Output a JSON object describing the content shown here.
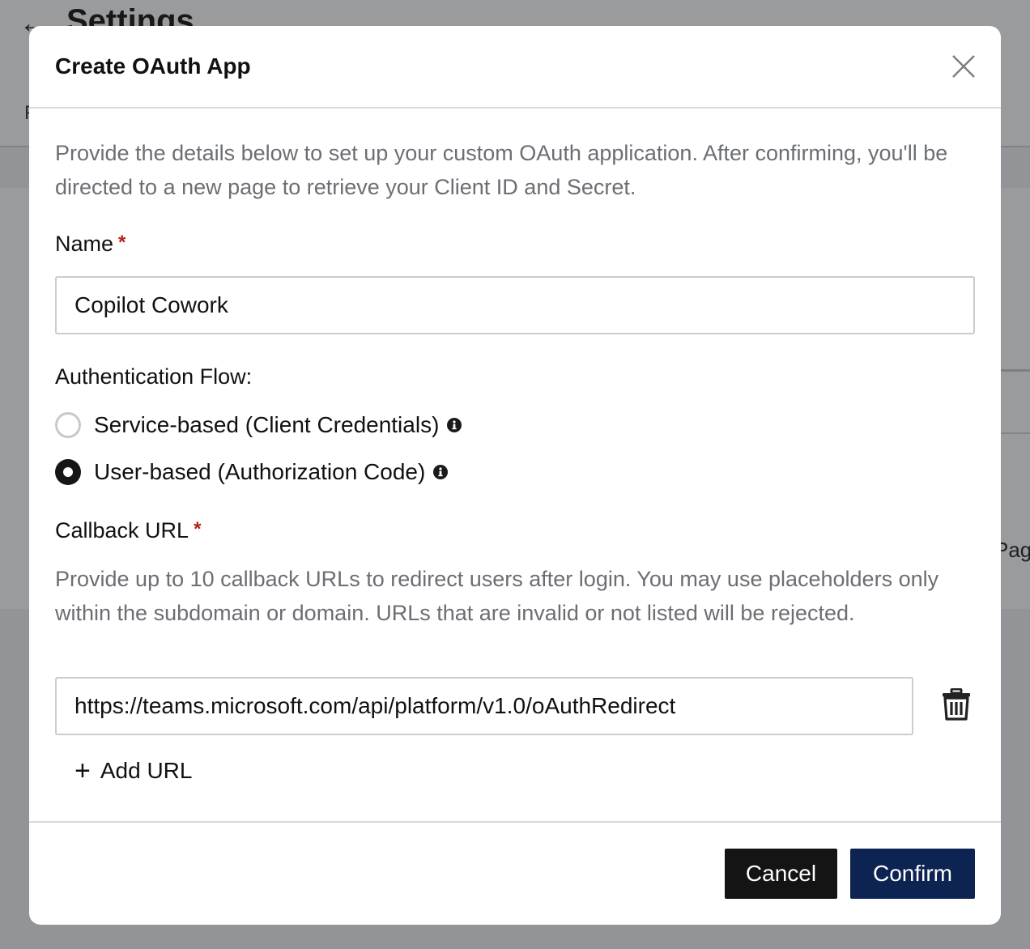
{
  "background": {
    "back_arrow": "←",
    "page_title": "Settings",
    "tab_fragment": "F",
    "pagination_fragment": "Pag"
  },
  "modal": {
    "title": "Create OAuth App",
    "close_icon": "close-icon",
    "intro": "Provide the details below to set up your custom OAuth application. After confirming, you'll be directed to a new page to retrieve your Client ID and Secret.",
    "name": {
      "label": "Name",
      "required_mark": "*",
      "value": "Copilot Cowork"
    },
    "auth_flow": {
      "label": "Authentication Flow:",
      "options": [
        {
          "label": "Service-based (Client Credentials)",
          "selected": false
        },
        {
          "label": "User-based (Authorization Code)",
          "selected": true
        }
      ]
    },
    "callback": {
      "label": "Callback URL",
      "required_mark": "*",
      "help": "Provide up to 10 callback URLs to redirect users after login. You may use placeholders only within the subdomain or domain. URLs that are invalid or not listed will be rejected.",
      "urls": [
        "https://teams.microsoft.com/api/platform/v1.0/oAuthRedirect"
      ],
      "add_label": "Add URL"
    },
    "footer": {
      "cancel_label": "Cancel",
      "confirm_label": "Confirm"
    }
  },
  "colors": {
    "confirm_bg": "#0d2352",
    "cancel_bg": "#141414",
    "required": "#b42318"
  }
}
